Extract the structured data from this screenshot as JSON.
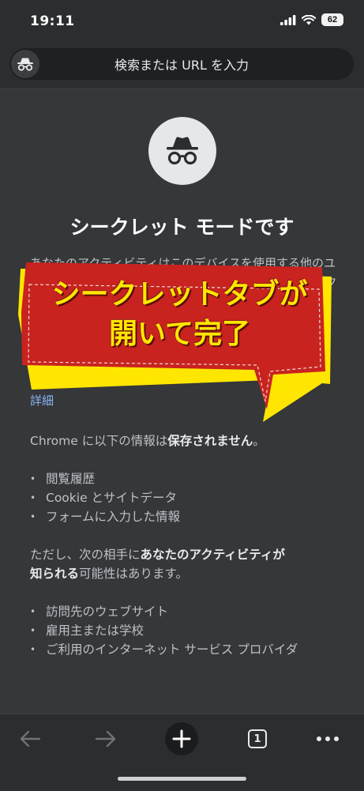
{
  "status_bar": {
    "time": "19:11",
    "battery": "62"
  },
  "omnibox": {
    "placeholder": "検索または URL を入力"
  },
  "page": {
    "title": "シークレット モードです",
    "description": "あなたのアクティビティはこのデバイスを使用する他のユーザーに表示されません。ただし、ダウンロード、ブックマーク、リーディング リストのアイテムは保存されます。",
    "learn_more": "詳細",
    "not_saved": {
      "prefix": "Chrome に以下の情報は",
      "bold": "保存されません",
      "suffix": "。"
    },
    "not_saved_items": [
      "閲覧履歴",
      "Cookie とサイトデータ",
      "フォームに入力した情報"
    ],
    "visible_to": {
      "prefix": "ただし、次の相手に",
      "bold1": "あなたのアクティビティが",
      "bold2": "知られる",
      "suffix": "可能性はあります。"
    },
    "visible_to_items": [
      "訪問先のウェブサイト",
      "雇用主または学校",
      "ご利用のインターネット サービス プロバイダ"
    ]
  },
  "callout": {
    "line1": "シークレットタブが",
    "line2": "開いて完了"
  },
  "toolbar": {
    "tab_count": "1"
  },
  "icons": {
    "incognito": "incognito-icon",
    "back": "back-arrow-icon",
    "forward": "forward-arrow-icon",
    "new_tab": "plus-icon",
    "tab_switcher": "tab-switcher-icon",
    "menu": "more-dots-icon"
  },
  "colors": {
    "background": "#353739",
    "link": "#8ab4f8",
    "callout_fill": "#c8231f",
    "callout_border": "#ffe600",
    "callout_text": "#ffe600"
  }
}
